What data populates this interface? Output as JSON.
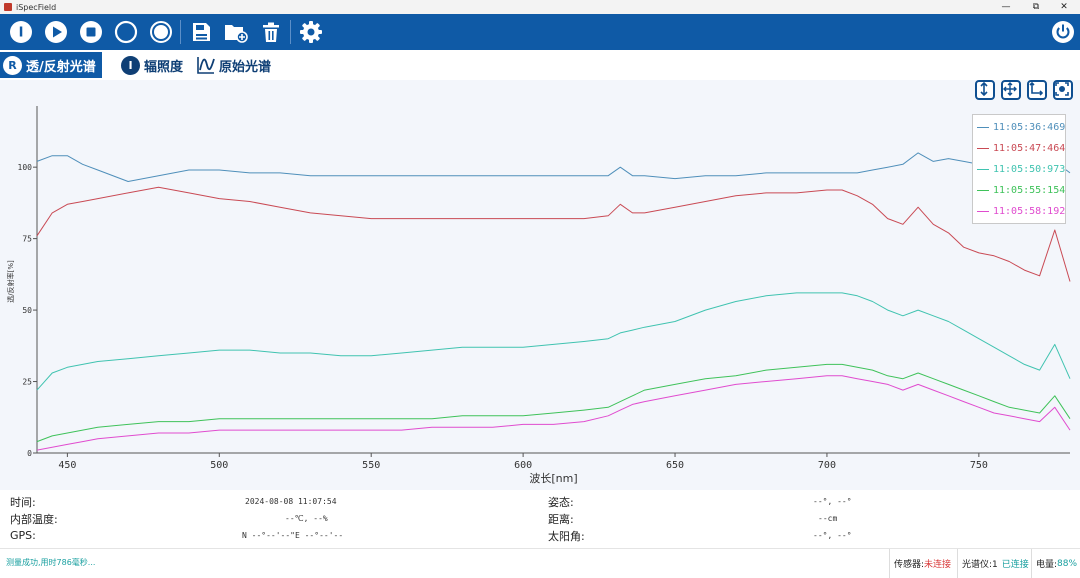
{
  "window": {
    "title": "iSpecField",
    "minimize": "—",
    "maximize": "⧉",
    "close": "✕"
  },
  "toolbar": {
    "buttons": [
      "info-icon",
      "play-icon",
      "stop-icon",
      "circle-icon",
      "circle-filled-icon",
      "save-icon",
      "folder-open-icon",
      "trash-icon",
      "gear-icon",
      "power-icon"
    ]
  },
  "tabs": [
    {
      "badge": "R",
      "label": "透/反射光谱",
      "active": true
    },
    {
      "badge": "I",
      "label": "辐照度",
      "active": false
    },
    {
      "badge": "",
      "label": "原始光谱",
      "active": false
    }
  ],
  "chart_data": {
    "type": "line",
    "xlabel": "波长[nm]",
    "ylabel": "透/反射率[%]",
    "xlim": [
      440,
      780
    ],
    "ylim": [
      0,
      120
    ],
    "xticks": [
      450,
      500,
      550,
      600,
      650,
      700,
      750
    ],
    "yticks": [
      0,
      25,
      50,
      75,
      100
    ],
    "grid": false,
    "legend_position": "top-right",
    "series": [
      {
        "name": "11:05:36:469",
        "color": "#4f8fba",
        "x": [
          440,
          445,
          450,
          455,
          460,
          470,
          480,
          490,
          500,
          510,
          520,
          530,
          540,
          550,
          560,
          570,
          580,
          590,
          600,
          610,
          620,
          628,
          632,
          636,
          640,
          650,
          660,
          670,
          680,
          690,
          700,
          705,
          710,
          715,
          720,
          725,
          730,
          735,
          740,
          745,
          750,
          755,
          760,
          765,
          770,
          775,
          780
        ],
        "y": [
          102,
          104,
          104,
          101,
          99,
          95,
          97,
          99,
          99,
          98,
          98,
          97,
          97,
          97,
          97,
          97,
          97,
          97,
          97,
          97,
          97,
          97,
          100,
          97,
          97,
          96,
          97,
          97,
          98,
          98,
          98,
          98,
          98,
          99,
          100,
          101,
          105,
          102,
          103,
          102,
          101,
          100,
          102,
          103,
          104,
          102,
          98
        ]
      },
      {
        "name": "11:05:47:464",
        "color": "#c94a54",
        "x": [
          440,
          445,
          450,
          455,
          460,
          470,
          480,
          490,
          500,
          510,
          520,
          530,
          540,
          550,
          560,
          570,
          580,
          590,
          600,
          610,
          620,
          628,
          632,
          636,
          640,
          650,
          660,
          670,
          680,
          690,
          700,
          705,
          710,
          715,
          720,
          725,
          730,
          735,
          740,
          745,
          750,
          755,
          760,
          765,
          770,
          775,
          780
        ],
        "y": [
          76,
          84,
          87,
          88,
          89,
          91,
          93,
          91,
          89,
          88,
          86,
          84,
          83,
          82,
          82,
          82,
          82,
          82,
          82,
          82,
          82,
          83,
          87,
          84,
          84,
          86,
          88,
          90,
          91,
          91,
          92,
          92,
          90,
          87,
          82,
          80,
          86,
          80,
          77,
          72,
          70,
          69,
          67,
          64,
          62,
          78,
          60
        ]
      },
      {
        "name": "11:05:50:973",
        "color": "#40c3b0",
        "x": [
          440,
          445,
          450,
          455,
          460,
          470,
          480,
          490,
          500,
          510,
          520,
          530,
          540,
          550,
          560,
          570,
          580,
          590,
          600,
          610,
          620,
          628,
          632,
          636,
          640,
          650,
          660,
          670,
          680,
          690,
          700,
          705,
          710,
          715,
          720,
          725,
          730,
          735,
          740,
          745,
          750,
          755,
          760,
          765,
          770,
          775,
          780
        ],
        "y": [
          22,
          28,
          30,
          31,
          32,
          33,
          34,
          35,
          36,
          36,
          35,
          35,
          34,
          34,
          35,
          36,
          37,
          37,
          37,
          38,
          39,
          40,
          42,
          43,
          44,
          46,
          50,
          53,
          55,
          56,
          56,
          56,
          55,
          53,
          50,
          48,
          50,
          48,
          46,
          43,
          40,
          37,
          34,
          31,
          29,
          38,
          26
        ]
      },
      {
        "name": "11:05:55:154",
        "color": "#3fc25a",
        "x": [
          440,
          445,
          450,
          455,
          460,
          470,
          480,
          490,
          500,
          510,
          520,
          530,
          540,
          550,
          560,
          570,
          580,
          590,
          600,
          610,
          620,
          628,
          632,
          636,
          640,
          650,
          660,
          670,
          680,
          690,
          700,
          705,
          710,
          715,
          720,
          725,
          730,
          735,
          740,
          745,
          750,
          755,
          760,
          765,
          770,
          775,
          780
        ],
        "y": [
          4,
          6,
          7,
          8,
          9,
          10,
          11,
          11,
          12,
          12,
          12,
          12,
          12,
          12,
          12,
          12,
          13,
          13,
          13,
          14,
          15,
          16,
          18,
          20,
          22,
          24,
          26,
          27,
          29,
          30,
          31,
          31,
          30,
          29,
          27,
          26,
          28,
          26,
          24,
          22,
          20,
          18,
          16,
          15,
          14,
          20,
          12
        ]
      },
      {
        "name": "11:05:58:192",
        "color": "#e04ccf",
        "x": [
          440,
          445,
          450,
          455,
          460,
          470,
          480,
          490,
          500,
          510,
          520,
          530,
          540,
          550,
          560,
          570,
          580,
          590,
          600,
          610,
          620,
          628,
          632,
          636,
          640,
          650,
          660,
          670,
          680,
          690,
          700,
          705,
          710,
          715,
          720,
          725,
          730,
          735,
          740,
          745,
          750,
          755,
          760,
          765,
          770,
          775,
          780
        ],
        "y": [
          1,
          2,
          3,
          4,
          5,
          6,
          7,
          7,
          8,
          8,
          8,
          8,
          8,
          8,
          8,
          9,
          9,
          9,
          10,
          10,
          11,
          13,
          15,
          17,
          18,
          20,
          22,
          24,
          25,
          26,
          27,
          27,
          26,
          25,
          24,
          22,
          24,
          22,
          20,
          18,
          16,
          14,
          13,
          12,
          11,
          16,
          8
        ]
      }
    ]
  },
  "info": {
    "time_label": "时间:",
    "time_value": "2024-08-08 11:07:54",
    "temp_label": "内部温度:",
    "temp_value": "--℃, --%",
    "gps_label": "GPS:",
    "gps_value": "N --°--'--\"E --°--'--",
    "pose_label": "姿态:",
    "pose_value": "--°, --°",
    "dist_label": "距离:",
    "dist_value": "--cm",
    "sun_label": "太阳角:",
    "sun_value": "--°, --°"
  },
  "status": {
    "message": "测量成功,用时786毫秒...",
    "sensor_label": "传感器:",
    "sensor_value": "未连接",
    "sensor_color": "#d93b3b",
    "spectro_label": "光谱仪:1",
    "spectro_value": "已连接",
    "spectro_color": "#1aa0a0",
    "battery_label": "电量:",
    "battery_value": "88%",
    "battery_color": "#1aa0a0"
  }
}
